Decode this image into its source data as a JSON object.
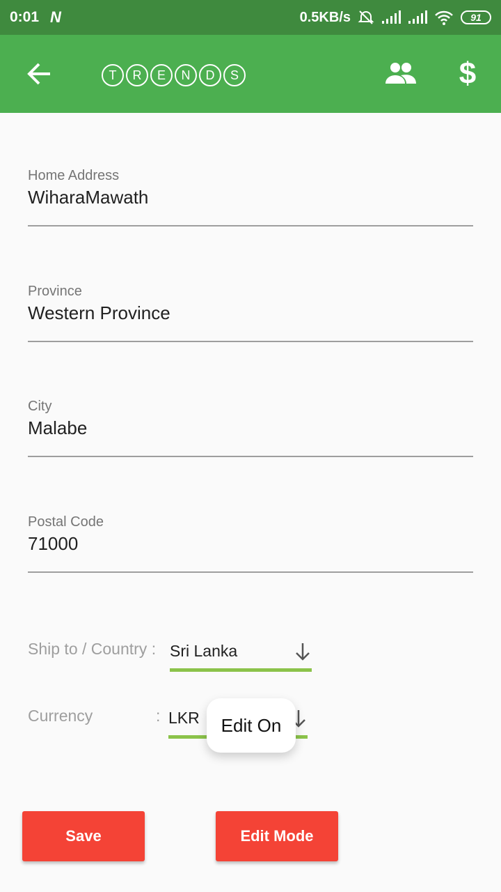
{
  "status_bar": {
    "time": "0:01",
    "network_speed": "0.5KB/s",
    "battery": "91",
    "icons": [
      "n-notification-icon",
      "alarm-off-icon",
      "signal-icon",
      "signal-icon",
      "wifi-icon",
      "battery-icon"
    ]
  },
  "app_bar": {
    "title_letters": [
      "T",
      "R",
      "E",
      "N",
      "D",
      "S"
    ],
    "back_icon": "arrow-left-icon",
    "people_icon": "people-icon",
    "dollar_symbol": "$"
  },
  "form": {
    "home_address": {
      "label": "Home Address",
      "value": "WiharaMawath"
    },
    "province": {
      "label": "Province",
      "value": "Western Province"
    },
    "city": {
      "label": "City",
      "value": "Malabe"
    },
    "postal_code": {
      "label": "Postal Code",
      "value": "71000"
    },
    "ship_to": {
      "label": "Ship to / Country :",
      "value": "Sri Lanka"
    },
    "currency": {
      "label": "Currency",
      "colon": ":",
      "value": "LKR"
    }
  },
  "toast": {
    "text": "Edit On"
  },
  "buttons": {
    "save": "Save",
    "edit_mode": "Edit Mode"
  },
  "colors": {
    "status_bar": "#3f8a3e",
    "app_bar": "#4caf50",
    "dropdown_underline": "#8bc34a",
    "button": "#f44336"
  }
}
